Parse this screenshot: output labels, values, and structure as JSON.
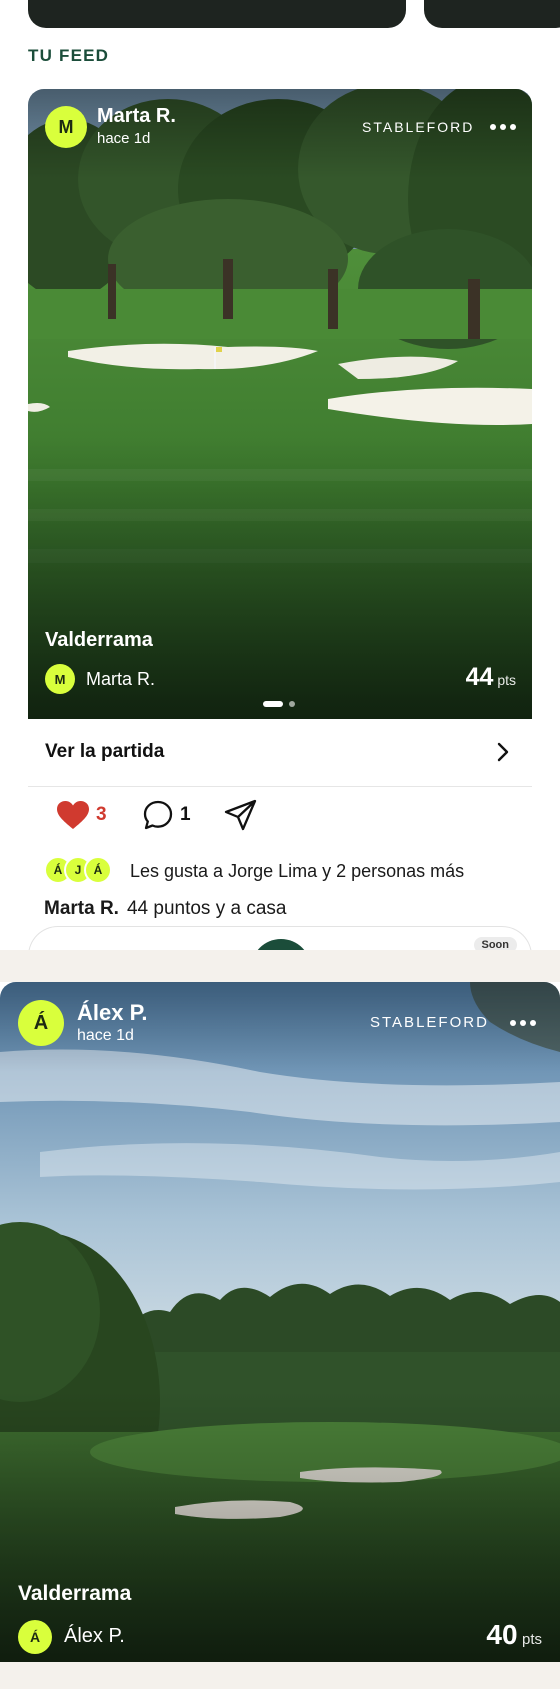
{
  "feed": {
    "section_title": "TU FEED"
  },
  "posts": [
    {
      "user_initial": "M",
      "user_name": "Marta R.",
      "time_ago": "hace 1d",
      "game_format": "STABLEFORD",
      "course_name": "Valderrama",
      "player_initial": "M",
      "player_name": "Marta R.",
      "score_value": "44",
      "score_unit": "pts",
      "carousel_pages": 2,
      "carousel_active": 1,
      "view_round_label": "Ver la partida",
      "likes_count": "3",
      "comments_count": "1",
      "likers_initials": [
        "Á",
        "J",
        "Á"
      ],
      "likes_text": "Les gusta a Jorge Lima y 2 personas más",
      "caption_author": "Marta R.",
      "caption_text": "44 puntos y a casa"
    },
    {
      "user_initial": "Á",
      "user_name": "Álex P.",
      "time_ago": "hace 1d",
      "game_format": "STABLEFORD",
      "course_name": "Valderrama",
      "player_initial": "Á",
      "player_name": "Álex P.",
      "score_value": "40",
      "score_unit": "pts"
    }
  ],
  "tabbar": {
    "soon_badge": "Soon"
  },
  "colors": {
    "brand_green": "#1b4d3a",
    "avatar_lime": "#d9ff3c",
    "like_red": "#d03a2f"
  },
  "icons": [
    "more-horizontal-icon",
    "chevron-right-icon",
    "heart-icon",
    "comment-icon",
    "send-icon"
  ]
}
